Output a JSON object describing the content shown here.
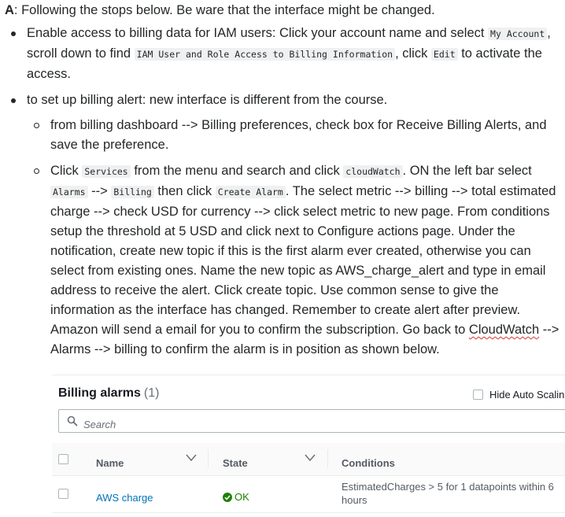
{
  "answer": {
    "prefix": "A",
    "intro": ": Following the stops below. Be ware that the interface might be changed.",
    "bullet1": {
      "t1": "Enable access to billing data for IAM users: Click your account name and select ",
      "c1": "My Account",
      "t2": ", scroll down to find ",
      "c2": "IAM User and Role Access to Billing Information",
      "t3": ", click ",
      "c3": "Edit",
      "t4": " to activate the access."
    },
    "bullet2": {
      "text": "to set up billing alert: new interface is different from the course.",
      "sub1": "from billing dashboard --> Billing preferences, check box for Receive Billing Alerts, and save the preference.",
      "sub2": {
        "t1": "Click ",
        "c1": "Services",
        "t2": " from the menu and search and click ",
        "c2": "cloudWatch",
        "t3": ".  ON the left bar select ",
        "c3": "Alarms",
        "t4": " --> ",
        "c4": "Billing",
        "t5": " then click ",
        "c5": "Create Alarm",
        "t6": ". The select metric --> billing --> total estimated charge --> check USD for currency --> click select metric to new page. From conditions setup the threshold at 5 USD and click next to Configure actions page. Under the notification, create new topic if this is the first alarm ever created, otherwise you can select from existing ones. Name the new topic as AWS_charge_alert and type in email address to receive the alert. Click create topic. Use common sense to give the information as the interface has changed. Remember to create alert after preview. Amazon will send a email for you to confirm the subscription. Go back to ",
        "t7": "CloudWatch",
        "t8": " --> Alarms --> billing to confirm the alarm is in position as shown below."
      }
    }
  },
  "aws_table": {
    "title": "Billing alarms",
    "count": "(1)",
    "hide_label": "Hide Auto Scalin",
    "search_placeholder": "Search",
    "columns": {
      "name": "Name",
      "state": "State",
      "conditions": "Conditions"
    },
    "row": {
      "name": "AWS charge",
      "state": "OK",
      "conditions": "EstimatedCharges > 5 for 1 datapoints within 6 hours"
    },
    "colors": {
      "link": "#0073bb",
      "ok": "#1d8102"
    }
  }
}
